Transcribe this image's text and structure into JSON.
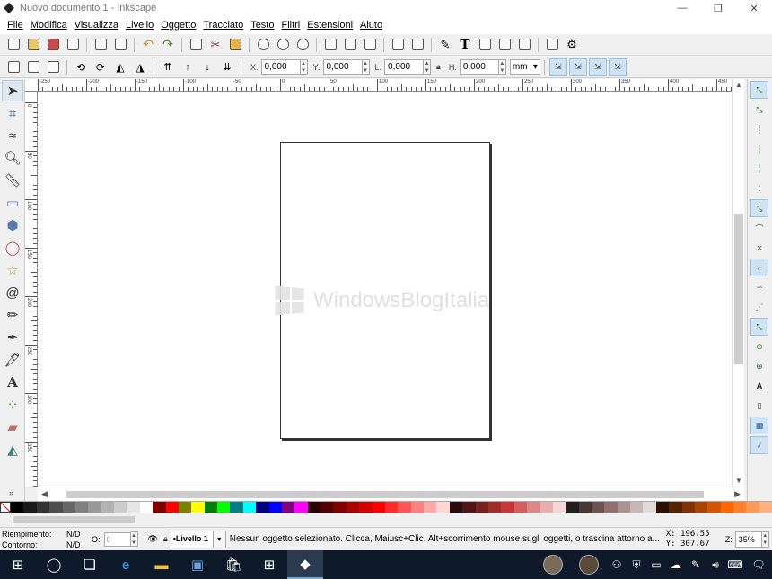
{
  "window": {
    "title": "Nuovo documento 1 - Inkscape",
    "controls": [
      "—",
      "❐",
      "✕"
    ]
  },
  "menu": [
    "File",
    "Modifica",
    "Visualizza",
    "Livello",
    "Oggetto",
    "Tracciato",
    "Testo",
    "Filtri",
    "Estensioni",
    "Aiuto"
  ],
  "coords": {
    "x_label": "X:",
    "x": "0,000",
    "y_label": "Y:",
    "y": "0,000",
    "w_label": "L:",
    "w": "0,000",
    "h_label": "H:",
    "h": "0,000",
    "unit": "mm"
  },
  "ruler": {
    "top_numbers": [
      "-250",
      "-200",
      "-150",
      "-100",
      "-50",
      "0",
      "50",
      "100",
      "150",
      "200",
      "250",
      "300",
      "350",
      "400",
      "450"
    ],
    "left_numbers": [
      "0",
      "50",
      "100",
      "150",
      "200",
      "250",
      "300",
      "350",
      "400"
    ]
  },
  "watermark": "WindowsBlogItalia",
  "status": {
    "fill_label": "Riempimento:",
    "fill_value": "N/D",
    "stroke_label": "Contorno:",
    "stroke_value": "N/D",
    "opacity_label": "O:",
    "opacity_value": "0",
    "layer": "•Livello 1",
    "message": "Nessun oggetto selezionato. Clicca, Maiusc+Clic, Alt+scorrimento mouse sugli oggetti, o trascina attorno a...",
    "cursor_x": "X:  196,55",
    "cursor_y": "Y:  307,67",
    "zoom_label": "Z:",
    "zoom_value": "35%"
  },
  "palette_colors": [
    "#000000",
    "#1a1a1a",
    "#333333",
    "#4d4d4d",
    "#666666",
    "#808080",
    "#999999",
    "#b3b3b3",
    "#cccccc",
    "#e6e6e6",
    "#ffffff",
    "#800000",
    "#ff0000",
    "#808000",
    "#ffff00",
    "#008000",
    "#00ff00",
    "#008080",
    "#00ffff",
    "#000080",
    "#0000ff",
    "#800080",
    "#ff00ff",
    "#2b0000",
    "#550000",
    "#800000",
    "#aa0000",
    "#d40000",
    "#ff0000",
    "#ff2a2a",
    "#ff5555",
    "#ff8080",
    "#ffaaaa",
    "#ffd5d5",
    "#280b0b",
    "#501616",
    "#782121",
    "#a02c2c",
    "#c83737",
    "#d35f5f",
    "#de8787",
    "#e9afaf",
    "#f4d7d7",
    "#241c1c",
    "#483737",
    "#6c5353",
    "#916f6f",
    "#ac9393",
    "#c8b7b7",
    "#e3dbdb",
    "#2b1100",
    "#552200",
    "#803300",
    "#aa4400",
    "#d45500",
    "#ff6600",
    "#ff7f2a",
    "#ff9955",
    "#ffb380"
  ]
}
